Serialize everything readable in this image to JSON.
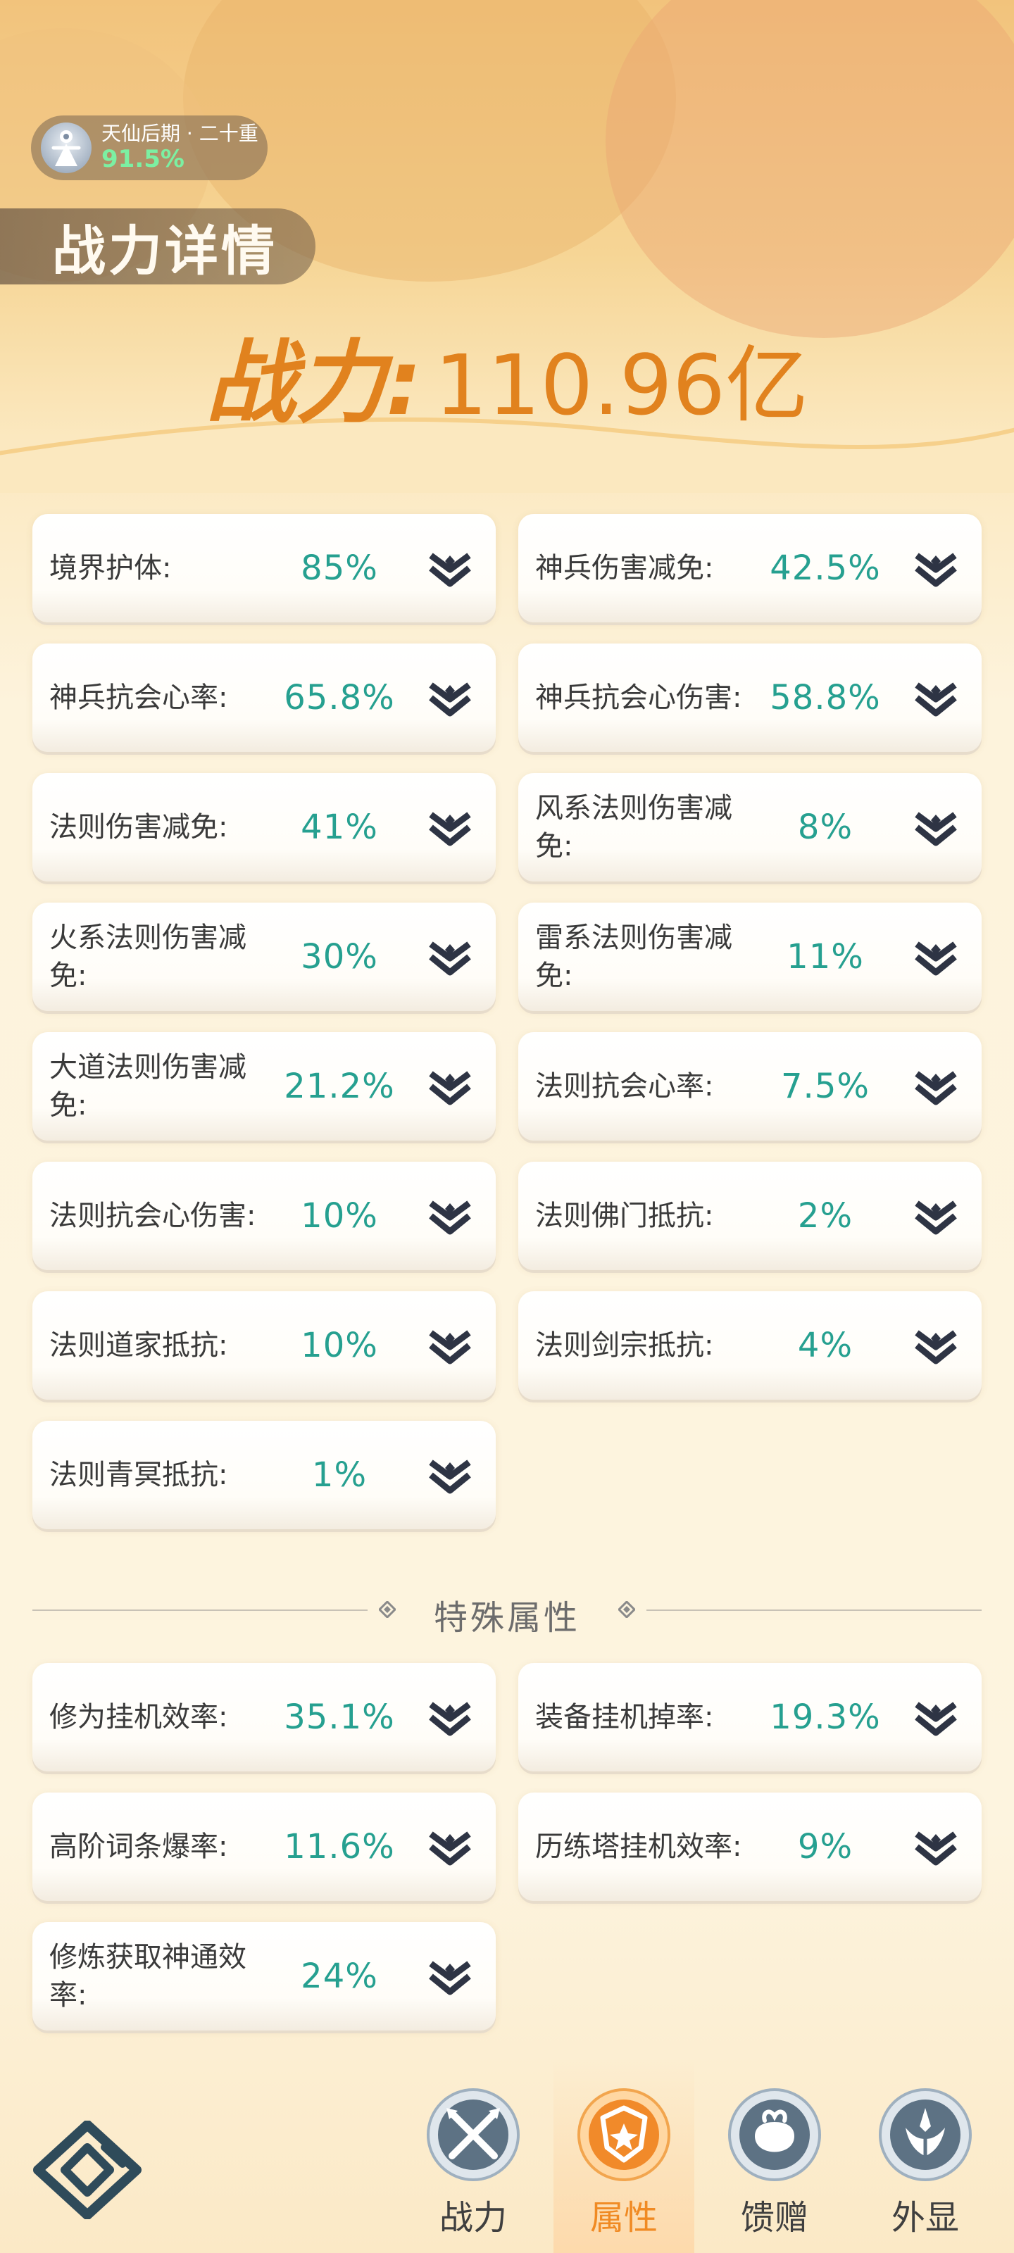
{
  "header": {
    "realm": "天仙后期 · 二十重",
    "realm_progress": "91.5%",
    "title": "战力详情",
    "power_label": "战力",
    "power_colon": ":",
    "power_value": "110.96亿"
  },
  "stats": [
    {
      "label": "境界护体:",
      "value": "85%"
    },
    {
      "label": "神兵伤害减免:",
      "value": "42.5%"
    },
    {
      "label": "神兵抗会心率:",
      "value": "65.8%"
    },
    {
      "label": "神兵抗会心伤害:",
      "value": "58.8%"
    },
    {
      "label": "法则伤害减免:",
      "value": "41%"
    },
    {
      "label": "风系法则伤害减免:",
      "value": "8%"
    },
    {
      "label": "火系法则伤害减免:",
      "value": "30%"
    },
    {
      "label": "雷系法则伤害减免:",
      "value": "11%"
    },
    {
      "label": "大道法则伤害减免:",
      "value": "21.2%"
    },
    {
      "label": "法则抗会心率:",
      "value": "7.5%"
    },
    {
      "label": "法则抗会心伤害:",
      "value": "10%"
    },
    {
      "label": "法则佛门抵抗:",
      "value": "2%"
    },
    {
      "label": "法则道家抵抗:",
      "value": "10%"
    },
    {
      "label": "法则剑宗抵抗:",
      "value": "4%"
    },
    {
      "label": "法则青冥抵抗:",
      "value": "1%"
    }
  ],
  "special_section": {
    "title": "特殊属性",
    "stats": [
      {
        "label": "修为挂机效率:",
        "value": "35.1%"
      },
      {
        "label": "装备挂机掉率:",
        "value": "19.3%"
      },
      {
        "label": "高阶词条爆率:",
        "value": "11.6%"
      },
      {
        "label": "历练塔挂机效率:",
        "value": "9%"
      },
      {
        "label": "修炼获取神通效率:",
        "value": "24%"
      }
    ]
  },
  "bottom_nav": {
    "items": [
      {
        "label": "战力",
        "icon": "crossed-swords-icon",
        "active": false
      },
      {
        "label": "属性",
        "icon": "shield-star-icon",
        "active": true
      },
      {
        "label": "馈赠",
        "icon": "gift-pouch-icon",
        "active": false
      },
      {
        "label": "外显",
        "icon": "crown-wings-icon",
        "active": false
      }
    ]
  },
  "colors": {
    "power": "#e1821e",
    "value": "#26a090",
    "active_tab": "#f08a23",
    "realm_progress": "#7cf0a2"
  }
}
